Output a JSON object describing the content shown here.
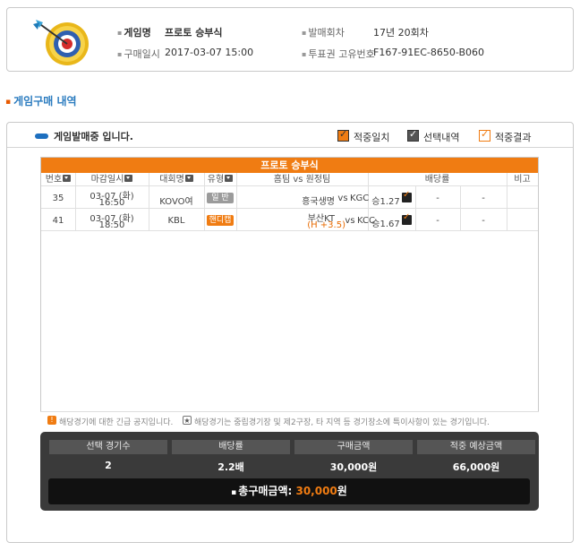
{
  "info": {
    "game_name_label": "게임명",
    "game_name": "프로토 승부식",
    "round_label": "발매회차",
    "round": "17년 20회차",
    "purchase_date_label": "구매일시",
    "purchase_date": "2017-03-07 15:00",
    "ticket_id_label": "투표권 고유번호",
    "ticket_id": "F167-91EC-8650-B060"
  },
  "section_title": "게임구매 내역",
  "status": {
    "text": "게임발매중 입니다.",
    "legend": [
      "적중일치",
      "선택내역",
      "적중결과"
    ]
  },
  "table": {
    "title": "프로토 승부식",
    "headers": {
      "no": "번호",
      "deadline": "마감일시",
      "league": "대회명",
      "type": "유형",
      "teams": "홈팀 vs 원정팀",
      "odds": "배당률",
      "note": "비고"
    },
    "rows": [
      {
        "no": "35",
        "date": "03-07 (화)",
        "time": "16:50",
        "league": "KOVO여",
        "type": "일 반",
        "home": "흥국생명",
        "vs": "vs",
        "away": "KGC",
        "odds1": "승1.27",
        "odds2": "-",
        "odds3": "-"
      },
      {
        "no": "41",
        "date": "03-07 (화)",
        "time": "18:50",
        "league": "KBL",
        "type": "핸디캡",
        "home": "부산KT",
        "handicap": "(H +3.5)",
        "vs": "vs",
        "away": "KCC",
        "odds1": "승1.67",
        "odds2": "-",
        "odds3": "-"
      }
    ]
  },
  "notices": {
    "n1": "해당경기에 대한 긴급 공지입니다.",
    "n2": "해당경기는 중립경기장 및 제2구장, 타 지역 등 경기장소에 특이사항이 있는 경기입니다."
  },
  "summary": {
    "headers": [
      "선택 경기수",
      "배당률",
      "구매금액",
      "적중 예상금액"
    ],
    "values": [
      "2",
      "2.2배",
      "30,000원",
      "66,000원"
    ],
    "total_label": "총구매금액:",
    "total_amount": "30,000",
    "total_unit": "원"
  },
  "colors": {
    "accent": "#f07c12",
    "title_blue": "#2a7bbf",
    "summary_bg": "#3a3a3a"
  }
}
